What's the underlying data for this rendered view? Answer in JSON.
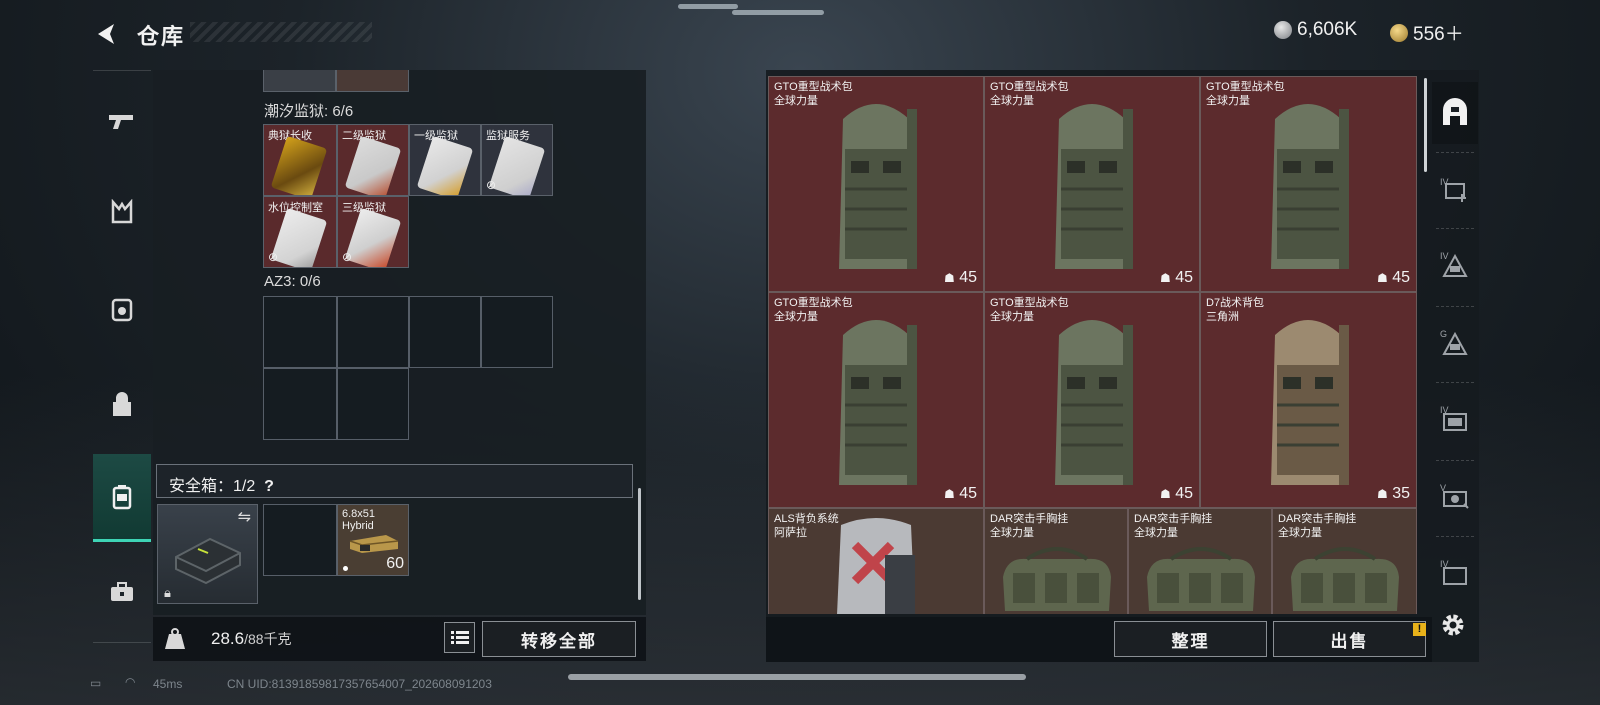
{
  "header": {
    "title": "仓库",
    "currency1": "6,606K",
    "currency2": "556＋"
  },
  "left_nav": {
    "items": [
      "gun-icon",
      "armor-icon",
      "vest-icon",
      "backpack-icon",
      "case-icon",
      "toolbox-icon"
    ],
    "active": 4
  },
  "left_panel": {
    "section1_label": "潮汐监狱: 6/6",
    "keys": [
      {
        "name": "典狱长收",
        "color": "#5a2a2c"
      },
      {
        "name": "二级监狱",
        "color": "#5a2a2c"
      },
      {
        "name": "一级监狱",
        "color": "#2f333d"
      },
      {
        "name": "监狱服务",
        "color": "#2f333d"
      },
      {
        "name": "水位控制室",
        "color": "#5a2a2c"
      },
      {
        "name": "三级监狱",
        "color": "#5a2a2c"
      }
    ],
    "section2_label": "AZ3: 0/6",
    "safe_label": "安全箱：1/2",
    "safe_help": "?",
    "ammo": {
      "name_line1": "6.8x51",
      "name_line2": "Hybrid",
      "count": "60"
    }
  },
  "left_bottom": {
    "weight": "28.6",
    "capacity": "/88千克",
    "transfer_label": "转移全部",
    "kg_icon": "KG"
  },
  "items": [
    {
      "name": "GTO重型战术包",
      "sub": "全球力量",
      "count": "45",
      "type": "pack",
      "bg": "red"
    },
    {
      "name": "GTO重型战术包",
      "sub": "全球力量",
      "count": "45",
      "type": "pack",
      "bg": "red"
    },
    {
      "name": "GTO重型战术包",
      "sub": "全球力量",
      "count": "45",
      "type": "pack",
      "bg": "red"
    },
    {
      "name": "GTO重型战术包",
      "sub": "全球力量",
      "count": "45",
      "type": "pack",
      "bg": "red"
    },
    {
      "name": "GTO重型战术包",
      "sub": "全球力量",
      "count": "45",
      "type": "pack",
      "bg": "red"
    },
    {
      "name": "D7战术背包",
      "sub": "三角洲",
      "count": "35",
      "type": "pack-tan",
      "bg": "red"
    },
    {
      "name": "ALS背负系统",
      "sub": "阿萨拉",
      "count": "",
      "type": "als",
      "bg": "brown"
    },
    {
      "name": "DAR突击手胸挂",
      "sub": "全球力量",
      "count": "",
      "type": "duffel",
      "bg": "brown"
    },
    {
      "name": "DAR突击手胸挂",
      "sub": "全球力量",
      "count": "",
      "type": "duffel",
      "bg": "brown"
    },
    {
      "name": "DAR突击手胸挂",
      "sub": "全球力量",
      "count": "",
      "type": "duffel",
      "bg": "brown"
    }
  ],
  "right_nav": [
    "backpack-filter-icon",
    "IV-add-icon",
    "IV-filter-icon",
    "G-filter-icon",
    "IV-slot-icon",
    "V-filter-icon",
    "IV-bottom-icon"
  ],
  "right_bottom": {
    "sort_label": "整理",
    "sell_label": "出售",
    "warn": "!"
  },
  "status": {
    "ping": "45ms",
    "uid": "CN UID:81391859817357654007_202608091203"
  }
}
